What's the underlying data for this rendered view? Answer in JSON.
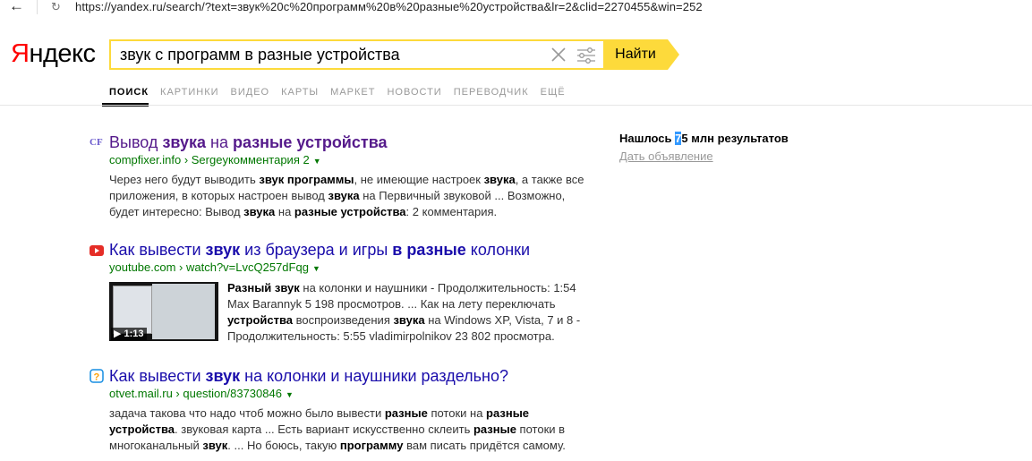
{
  "browser": {
    "url": "https://yandex.ru/search/?text=звук%20с%20программ%20в%20разные%20устройства&lr=2&clid=2270455&win=252"
  },
  "header": {
    "logo_first": "Я",
    "logo_rest": "ндекс",
    "query": "звук с программ в разные устройства",
    "find_label": "Найти"
  },
  "tabs": [
    "ПОИСК",
    "КАРТИНКИ",
    "ВИДЕО",
    "КАРТЫ",
    "МАРКЕТ",
    "НОВОСТИ",
    "ПЕРЕВОДЧИК",
    "ЕЩЁ"
  ],
  "results": [
    {
      "title_parts": [
        [
          "Вывод ",
          false
        ],
        [
          "звука",
          true
        ],
        [
          " на ",
          false
        ],
        [
          "разные устройства",
          true
        ]
      ],
      "url": "compfixer.info › Sergeyкомментария 2",
      "snippet_parts": [
        [
          "Через него будут выводить ",
          false
        ],
        [
          "звук программы",
          true
        ],
        [
          ", не имеющие настроек ",
          false
        ],
        [
          "звука",
          true
        ],
        [
          ", а также все приложения, в которых настроен вывод ",
          false
        ],
        [
          "звука",
          true
        ],
        [
          " на Первичный звуковой ... Возможно, будет интересно: Вывод ",
          false
        ],
        [
          "звука",
          true
        ],
        [
          " на ",
          false
        ],
        [
          "разные устройства",
          true
        ],
        [
          ": 2 комментария.",
          false
        ]
      ]
    },
    {
      "title_parts": [
        [
          "Как вывести ",
          false
        ],
        [
          "звук",
          true
        ],
        [
          " из браузера и игры ",
          false
        ],
        [
          "в разные",
          true
        ],
        [
          " колонки",
          false
        ]
      ],
      "url": "youtube.com › watch?v=LvcQ257dFqg",
      "duration": "1:13",
      "snippet_parts": [
        [
          "Разный звук",
          true
        ],
        [
          " на колонки и наушники - Продолжительность: 1:54 Max Barannyk 5 198 просмотров. ... Как на лету переключать ",
          false
        ],
        [
          "устройства",
          true
        ],
        [
          " воспроизведения ",
          false
        ],
        [
          "звука",
          true
        ],
        [
          " на Windows XP, Vista, 7 и 8 - Продолжительность: 5:55 vladimirpolnikov 23 802 просмотра.",
          false
        ]
      ]
    },
    {
      "title_parts": [
        [
          "Как вывести ",
          false
        ],
        [
          "звук",
          true
        ],
        [
          " на колонки и наушники раздельно?",
          false
        ]
      ],
      "url": "otvet.mail.ru › question/83730846",
      "snippet_parts": [
        [
          "задача такова что надо чтоб можно было вывести ",
          false
        ],
        [
          "разные",
          true
        ],
        [
          " потоки на ",
          false
        ],
        [
          "разные устройства",
          true
        ],
        [
          ". звуковая карта ... Есть вариант искусственно склеить ",
          false
        ],
        [
          "разные",
          true
        ],
        [
          " потоки в многоканальный ",
          false
        ],
        [
          "звук",
          true
        ],
        [
          ". ... Но боюсь, такую ",
          false
        ],
        [
          "программу",
          true
        ],
        [
          " вам писать придётся самому.",
          false
        ]
      ]
    }
  ],
  "sidebar": {
    "found_prefix": "Нашлось ",
    "found_cursor": "7",
    "found_rest": "5 млн результатов",
    "ad_link": "Дать объявление"
  },
  "colors": {
    "accent": "#fdda3b",
    "link": "#1a0dab",
    "visited": "#551a8b",
    "url": "#007700"
  }
}
